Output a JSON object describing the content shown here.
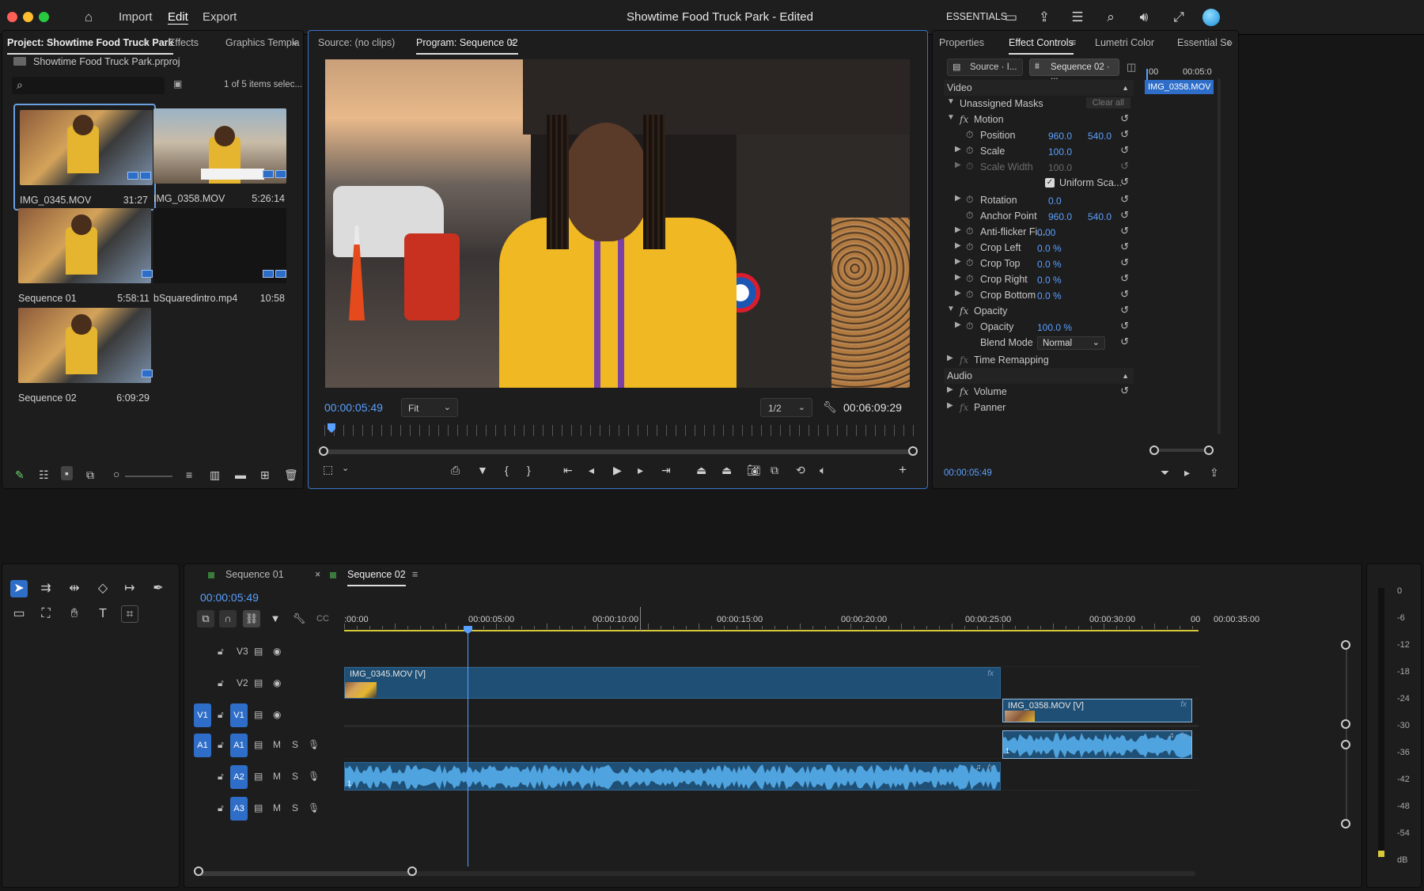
{
  "titlebar": {
    "menus": [
      "Import",
      "Edit",
      "Export"
    ],
    "active_menu": "Edit",
    "title": "Showtime Food Truck Park - Edited",
    "workspace": "ESSENTIALS"
  },
  "project_panel": {
    "tabs": [
      "Project: Showtime Food Truck Park",
      "Effects",
      "Graphics Templa"
    ],
    "project_file": "Showtime Food Truck Park.prproj",
    "search_placeholder": "",
    "selection_status": "1 of 5 items selec...",
    "items": [
      {
        "name": "IMG_0345.MOV",
        "duration": "31:27"
      },
      {
        "name": "IMG_0358.MOV",
        "duration": "5:26:14"
      },
      {
        "name": "Sequence 01",
        "duration": "5:58:11"
      },
      {
        "name": "bSquaredintro.mp4",
        "duration": "10:58"
      },
      {
        "name": "Sequence 02",
        "duration": "6:09:29"
      }
    ]
  },
  "monitor": {
    "source_tab": "Source: (no clips)",
    "program_tab": "Program: Sequence 02",
    "current_time": "00:00:05:49",
    "fit": "Fit",
    "resolution": "1/2",
    "duration": "00:06:09:29",
    "playhead_fraction": 0.012
  },
  "effect_controls": {
    "tabs": [
      "Properties",
      "Effect Controls",
      "Lumetri Color",
      "Essential Sc"
    ],
    "source_chip": "Source · I...",
    "sequence_chip": "Sequence 02 · ...",
    "ruler_start": ":00",
    "ruler_end": "00:05:0",
    "clip_label": "IMG_0358.MOV",
    "video_header": "Video",
    "unassigned_masks": "Unassigned Masks",
    "clear_all": "Clear all",
    "motion": "Motion",
    "position_label": "Position",
    "position_x": "960.0",
    "position_y": "540.0",
    "scale_label": "Scale",
    "scale_value": "100.0",
    "scale_width_label": "Scale Width",
    "scale_width_value": "100.0",
    "uniform_scale": "Uniform Sca...",
    "rotation_label": "Rotation",
    "rotation_value": "0.0",
    "anchor_label": "Anchor Point",
    "anchor_x": "960.0",
    "anchor_y": "540.0",
    "antiflicker_label": "Anti-flicker Fi...",
    "antiflicker_value": "0.00",
    "crop_left_label": "Crop Left",
    "crop_left_value": "0.0 %",
    "crop_top_label": "Crop Top",
    "crop_top_value": "0.0 %",
    "crop_right_label": "Crop Right",
    "crop_right_value": "0.0 %",
    "crop_bottom_label": "Crop Bottom",
    "crop_bottom_value": "0.0 %",
    "opacity_section": "Opacity",
    "opacity_label": "Opacity",
    "opacity_value": "100.0 %",
    "blend_label": "Blend Mode",
    "blend_value": "Normal",
    "time_remapping": "Time Remapping",
    "audio_header": "Audio",
    "volume": "Volume",
    "panner": "Panner",
    "footer_time": "00:00:05:49"
  },
  "timeline": {
    "tabs": [
      "Sequence 01",
      "Sequence 02"
    ],
    "active_tab": "Sequence 02",
    "current_time": "00:00:05:49",
    "ruler_labels": [
      ":00:00",
      "00:00:05:00",
      "00:00:10:00",
      "00:00:15:00",
      "00:00:20:00",
      "00:00:25:00",
      "00:00:30:00",
      "00:00:35:00",
      "00"
    ],
    "tracks": {
      "V3": "V3",
      "V2": "V2",
      "V1": "V1",
      "A1": "A1",
      "A2": "A2",
      "A3": "A3",
      "src_v1": "V1",
      "src_a1": "A1",
      "mute": "M",
      "solo": "S"
    },
    "clips": {
      "v2_clip": "IMG_0345.MOV [V]",
      "v1_clip": "IMG_0358.MOV [V]",
      "a_channel": "1"
    },
    "meter_labels": [
      "0",
      "-6",
      "-12",
      "-18",
      "-24",
      "-30",
      "-36",
      "-42",
      "-48",
      "-54",
      "dB"
    ]
  },
  "colors": {
    "accent": "#2f6ec8",
    "timecode": "#5aa0ff",
    "video_clip": "#1f4f74",
    "audio_clip": "#4fa3df"
  }
}
